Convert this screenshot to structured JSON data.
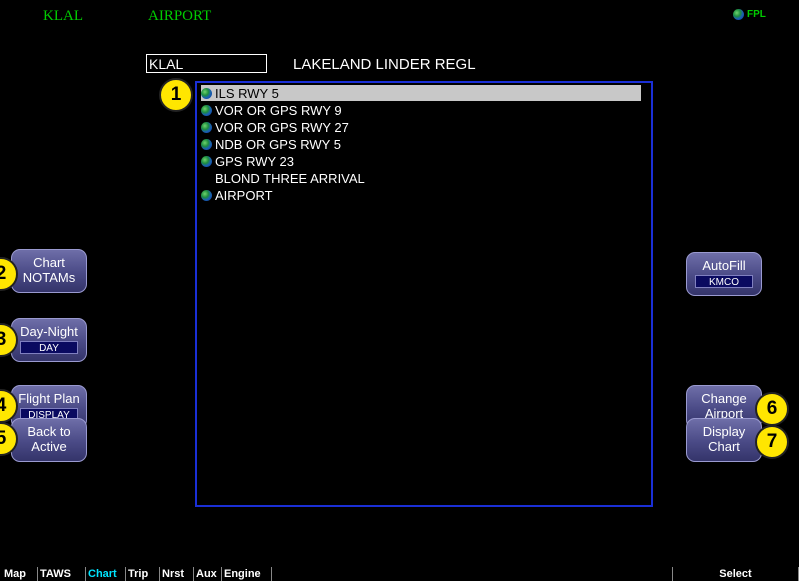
{
  "header": {
    "airport_id": "KLAL",
    "page_title": "AIRPORT",
    "fpl_label": "FPL"
  },
  "airport_field": {
    "value": "KLAL"
  },
  "airport_name": "LAKELAND LINDER REGL",
  "chart_list": [
    {
      "label": "ILS RWY 5",
      "globe": true,
      "selected": true
    },
    {
      "label": "VOR OR GPS RWY 9",
      "globe": true,
      "selected": false
    },
    {
      "label": "VOR OR GPS RWY 27",
      "globe": true,
      "selected": false
    },
    {
      "label": "NDB OR GPS RWY 5",
      "globe": true,
      "selected": false
    },
    {
      "label": "GPS RWY 23",
      "globe": true,
      "selected": false
    },
    {
      "label": "BLOND THREE ARRIVAL",
      "globe": false,
      "selected": false
    },
    {
      "label": "AIRPORT",
      "globe": true,
      "selected": false
    }
  ],
  "left_buttons": [
    {
      "line1": "Chart",
      "line2": "NOTAMs",
      "sub": ""
    },
    {
      "line1": "Day-Night",
      "line2": "",
      "sub": "DAY"
    },
    {
      "line1": "Flight Plan",
      "line2": "",
      "sub": "DISPLAY"
    },
    {
      "line1": "Back to",
      "line2": "Active",
      "sub": ""
    }
  ],
  "right_buttons": [
    {
      "line1": "AutoFill",
      "line2": "",
      "sub": "KMCO"
    },
    {
      "line1": "Change",
      "line2": "Airport",
      "sub": ""
    },
    {
      "line1": "Display",
      "line2": "Chart",
      "sub": ""
    }
  ],
  "callouts": [
    "1",
    "2",
    "3",
    "4",
    "5",
    "6",
    "7"
  ],
  "tabs": [
    "Map",
    "TAWS",
    "Chart",
    "Trip",
    "Nrst",
    "Aux",
    "Engine"
  ],
  "active_tab": "Chart",
  "select_label": "Select",
  "colors": {
    "header_green": "#00cc00",
    "list_border": "#1a2fd6",
    "selection": "#c8c8c8",
    "callout": "#ffe600",
    "active_tab": "#00e5ff"
  }
}
